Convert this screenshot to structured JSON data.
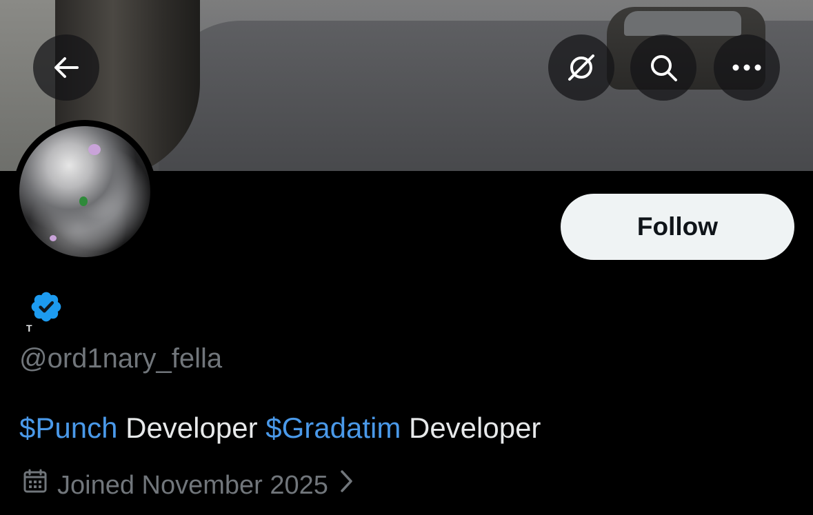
{
  "header": {
    "back_icon": "arrow-left-icon",
    "grok_icon": "grok-icon",
    "search_icon": "search-icon",
    "more_icon": "ellipsis-icon"
  },
  "profile": {
    "tiny_glyph": "T",
    "handle": "@ord1nary_fella",
    "verified": true,
    "verified_color": "#1d9bf0",
    "follow_label": "Follow"
  },
  "bio": {
    "segments": [
      {
        "text": "$Punch",
        "type": "cashtag"
      },
      {
        "text": " Developer ",
        "type": "text"
      },
      {
        "text": "$Gradatim",
        "type": "cashtag"
      },
      {
        "text": " Developer",
        "type": "text"
      }
    ],
    "cashtag_color": "#4a99e9"
  },
  "joined": {
    "text": "Joined November 2025",
    "icon": "calendar-icon",
    "chevron_icon": "chevron-right-icon"
  },
  "colors": {
    "background": "#000000",
    "primary_text": "#e7e9ea",
    "secondary_text": "#71767b",
    "follow_bg": "#eff3f4",
    "follow_text": "#0f1419"
  }
}
